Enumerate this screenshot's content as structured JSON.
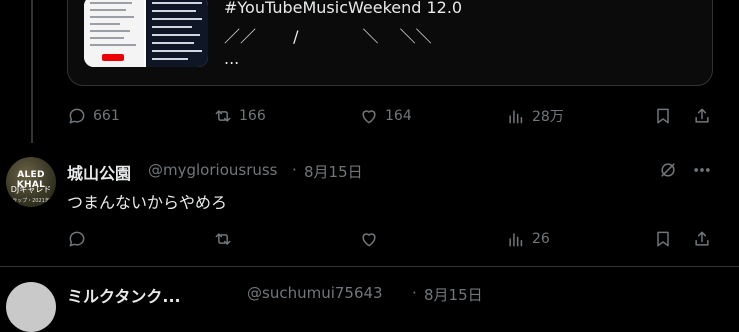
{
  "quoted_card": {
    "hashtag_line": "#YouTubeMusicWeekend 12.0",
    "symbols_line": "／／　　 /　　　　＼　 ＼＼",
    "ellipsis": "..."
  },
  "tweet1_actions": {
    "replies": "661",
    "retweets": "166",
    "likes": "164",
    "views": "28万"
  },
  "tweet2": {
    "avatar_text": {
      "line1": "ALED KHAL",
      "line2": "DJキャレド",
      "line3": "ラップ・2021年"
    },
    "display_name": "城山公園",
    "handle": "@mygloriousruss",
    "separator": "·",
    "date": "8月15日",
    "text": "つまんないからやめろ",
    "actions": {
      "replies": "",
      "retweets": "",
      "likes": "",
      "views": "26"
    }
  },
  "tweet3": {
    "display_name": "ミルクタンク...",
    "handle": "@suchumui75643",
    "separator": "·",
    "date": "8月15日"
  }
}
